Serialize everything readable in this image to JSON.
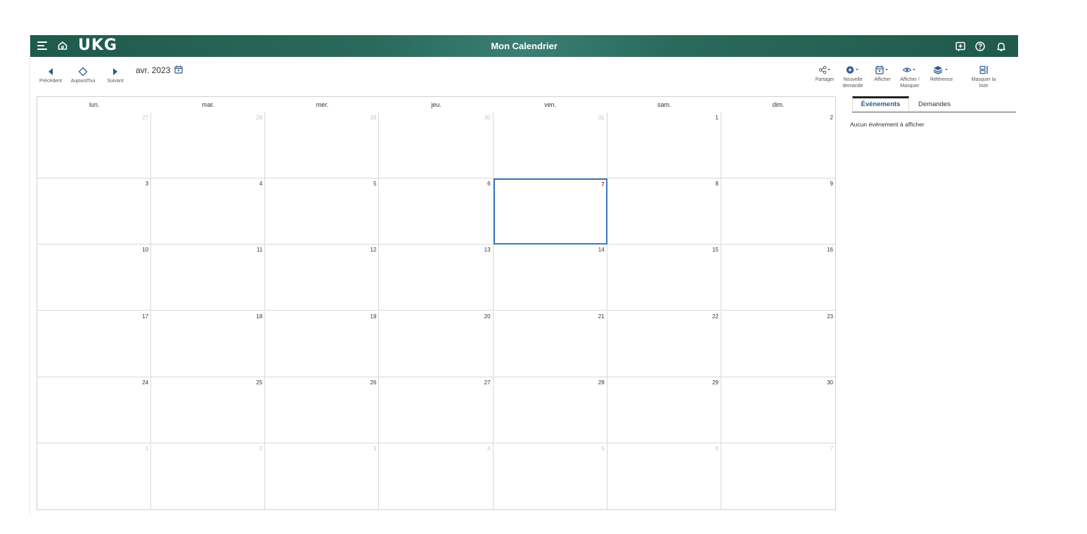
{
  "header": {
    "logo": "UKG",
    "title": "Mon Calendrier"
  },
  "nav": {
    "previous": "Précédent",
    "today": "Aujourd'hui",
    "next": "Suivant",
    "month": "avr. 2023"
  },
  "tools": {
    "share": "Partager",
    "new_request": "Nouvelle demande",
    "display": "Afficher",
    "show_hide": "Afficher / Masquer",
    "reference": "Référence",
    "hide_list": "Masquer la liste"
  },
  "calendar": {
    "days_of_week": [
      "lun.",
      "mar.",
      "mer.",
      "jeu.",
      "ven.",
      "sam.",
      "dim."
    ],
    "weeks": [
      [
        {
          "d": "27",
          "other": true
        },
        {
          "d": "28",
          "other": true
        },
        {
          "d": "29",
          "other": true
        },
        {
          "d": "30",
          "other": true
        },
        {
          "d": "31",
          "other": true
        },
        {
          "d": "1"
        },
        {
          "d": "2"
        }
      ],
      [
        {
          "d": "3"
        },
        {
          "d": "4"
        },
        {
          "d": "5"
        },
        {
          "d": "6"
        },
        {
          "d": "7",
          "today": true
        },
        {
          "d": "8"
        },
        {
          "d": "9"
        }
      ],
      [
        {
          "d": "10"
        },
        {
          "d": "11"
        },
        {
          "d": "12"
        },
        {
          "d": "13"
        },
        {
          "d": "14"
        },
        {
          "d": "15"
        },
        {
          "d": "16"
        }
      ],
      [
        {
          "d": "17"
        },
        {
          "d": "18"
        },
        {
          "d": "19"
        },
        {
          "d": "20"
        },
        {
          "d": "21"
        },
        {
          "d": "22"
        },
        {
          "d": "23"
        }
      ],
      [
        {
          "d": "24"
        },
        {
          "d": "25"
        },
        {
          "d": "26"
        },
        {
          "d": "27"
        },
        {
          "d": "28"
        },
        {
          "d": "29"
        },
        {
          "d": "30"
        }
      ],
      [
        {
          "d": "1",
          "other": true
        },
        {
          "d": "2",
          "other": true
        },
        {
          "d": "3",
          "other": true
        },
        {
          "d": "4",
          "other": true
        },
        {
          "d": "5",
          "other": true
        },
        {
          "d": "6",
          "other": true
        },
        {
          "d": "7",
          "other": true
        }
      ]
    ]
  },
  "side_panel": {
    "tabs": [
      {
        "label": "Événements",
        "active": true
      },
      {
        "label": "Demandes",
        "active": false
      }
    ],
    "empty_message": "Aucun événement à afficher"
  },
  "icons": {
    "menu": "hamburger-icon",
    "home": "home-icon",
    "chat": "chat-icon",
    "help": "help-icon",
    "bell": "bell-icon"
  },
  "colors": {
    "header_bg": "#2a6a5b",
    "accent": "#2a5b8f",
    "today_border": "#3a78c4",
    "today_number": "#d0213a"
  }
}
